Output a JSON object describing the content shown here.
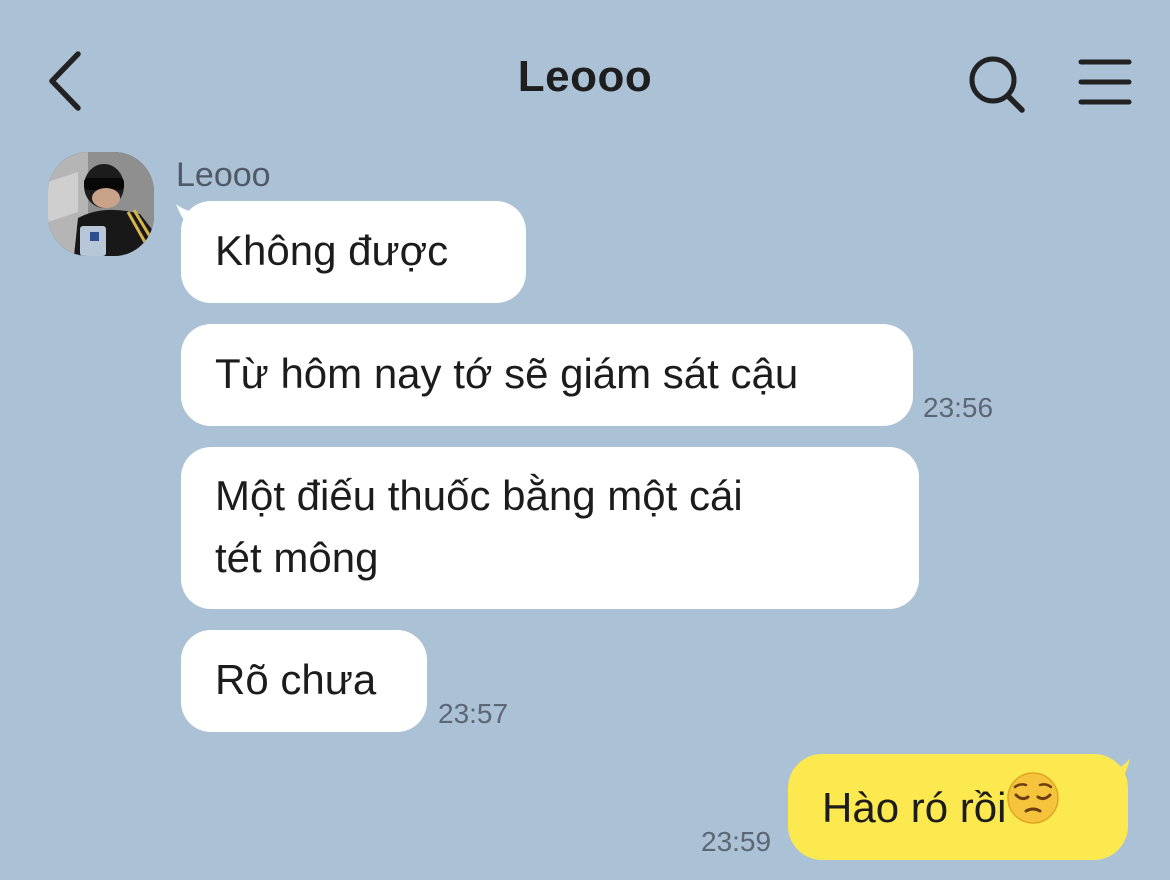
{
  "header": {
    "title": "Leooo",
    "back_icon": "chevron-left-icon",
    "search_icon": "search-icon",
    "menu_icon": "hamburger-menu-icon"
  },
  "incoming": {
    "sender_name": "Leooo",
    "avatar": "contact-avatar-photo",
    "messages": [
      {
        "text": "Không được"
      },
      {
        "text": "Từ hôm nay tớ sẽ giám sát cậu",
        "time": "23:56"
      },
      {
        "line1": "Một điếu thuốc bằng một cái",
        "line2": "tét mông"
      },
      {
        "text": "Rõ chưa",
        "time": "23:57"
      }
    ]
  },
  "outgoing": {
    "messages": [
      {
        "text": "Hào ró rồi",
        "emoji": "pensive-face-emoji",
        "time": "23:59"
      }
    ]
  },
  "colors": {
    "background": "#abc1d5",
    "incoming_bubble": "#ffffff",
    "outgoing_bubble": "#fce84f"
  }
}
